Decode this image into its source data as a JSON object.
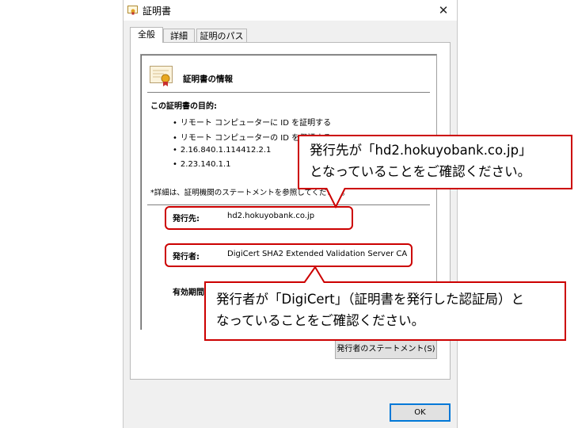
{
  "window": {
    "title": "証明書",
    "close_symbol": "✕"
  },
  "tabs": [
    {
      "label": "全般",
      "active": true
    },
    {
      "label": "詳細",
      "active": false
    },
    {
      "label": "証明のパス",
      "active": false
    }
  ],
  "cert_info": {
    "heading": "証明書の情報",
    "purpose_title": "この証明書の目的:",
    "purposes": [
      "リモート コンピューターに ID を証明する",
      "リモート コンピューターの ID を保証する",
      "2.16.840.1.114412.2.1",
      "2.23.140.1.1"
    ],
    "note": "*詳細は、証明機関のステートメントを参照してください。",
    "issued_to_label": "発行先:",
    "issued_to_value": "hd2.hokuyobank.co.jp",
    "issued_by_label": "発行者:",
    "issued_by_value": "DigiCert SHA2 Extended Validation Server CA",
    "validity_label": "有効期間"
  },
  "buttons": {
    "issuer_statement": "発行者のステートメント(S)",
    "ok": "OK"
  },
  "annotations": {
    "callout1_line1": "発行先が「hd2.hokuyobank.co.jp」",
    "callout1_line2": "となっていることをご確認ください。",
    "callout2_line1": "発行者が「DigiCert」（証明書を発行した認証局）と",
    "callout2_line2": "なっていることをご確認ください。"
  },
  "colors": {
    "annotation_red": "#cc0000",
    "ok_border": "#0078d7"
  }
}
